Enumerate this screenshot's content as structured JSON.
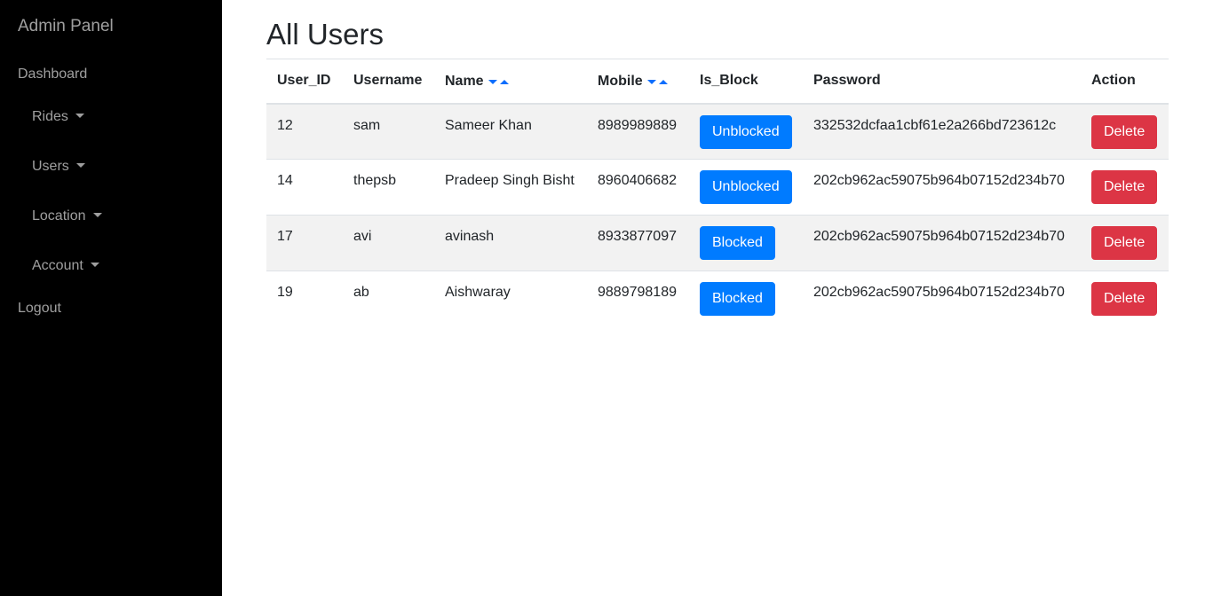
{
  "sidebar": {
    "brand": "Admin Panel",
    "items": [
      {
        "label": "Dashboard",
        "dropdown": false
      },
      {
        "label": "Rides",
        "dropdown": true
      },
      {
        "label": "Users",
        "dropdown": true
      },
      {
        "label": "Location",
        "dropdown": true
      },
      {
        "label": "Account",
        "dropdown": true
      },
      {
        "label": "Logout",
        "dropdown": false
      }
    ]
  },
  "main": {
    "title": "All Users",
    "columns": [
      "User_ID",
      "Username",
      "Name",
      "Mobile",
      "Is_Block",
      "Password",
      "Action"
    ],
    "rows": [
      {
        "user_id": "12",
        "username": "sam",
        "name": "Sameer Khan",
        "mobile": "8989989889",
        "is_block": "Unblocked",
        "password": "332532dcfaa1cbf61e2a266bd723612c",
        "action": "Delete"
      },
      {
        "user_id": "14",
        "username": "thepsb",
        "name": "Pradeep Singh Bisht",
        "mobile": "8960406682",
        "is_block": "Unblocked",
        "password": "202cb962ac59075b964b07152d234b70",
        "action": "Delete"
      },
      {
        "user_id": "17",
        "username": "avi",
        "name": "avinash",
        "mobile": "8933877097",
        "is_block": "Blocked",
        "password": "202cb962ac59075b964b07152d234b70",
        "action": "Delete"
      },
      {
        "user_id": "19",
        "username": "ab",
        "name": "Aishwaray",
        "mobile": "9889798189",
        "is_block": "Blocked",
        "password": "202cb962ac59075b964b07152d234b70",
        "action": "Delete"
      }
    ]
  },
  "colors": {
    "sidebar_bg": "#000000",
    "primary": "#007bff",
    "danger": "#dc3545",
    "sort_arrow": "#0d6efd",
    "row_stripe": "#f2f2f2"
  },
  "icons": {
    "dropdown": "caret-down-icon",
    "sort_desc": "sort-desc-icon",
    "sort_asc": "sort-asc-icon"
  }
}
